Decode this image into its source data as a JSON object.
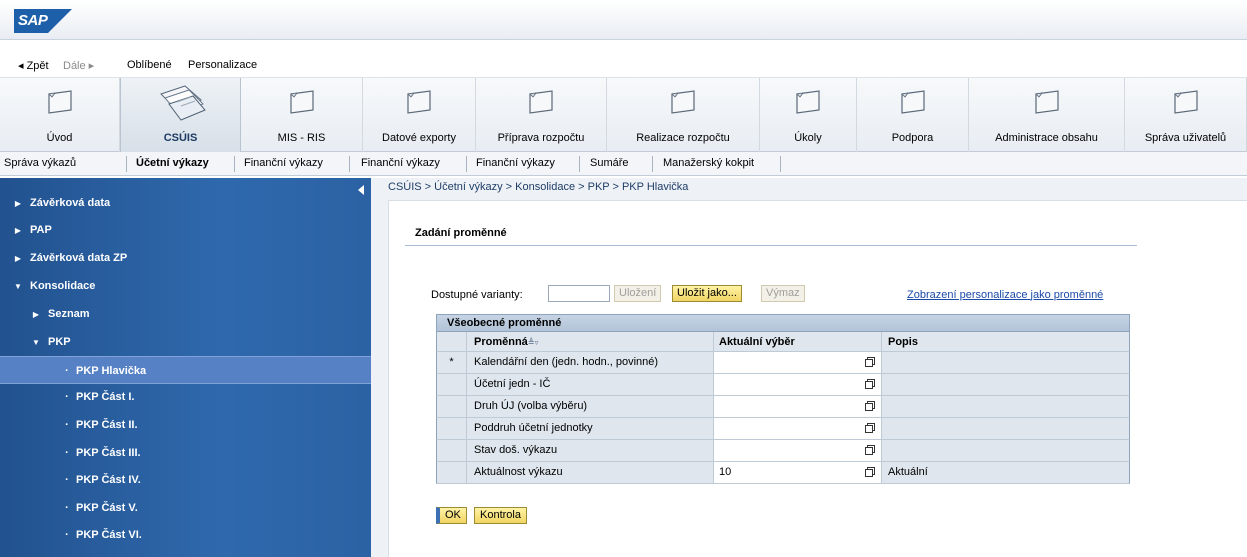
{
  "brand": {
    "logo_text": "SAP",
    "color": "#1d5fa8"
  },
  "history": {
    "back": "◂ Zpět",
    "forward": "Dále ▸",
    "favorites": "Oblíbené",
    "personalize": "Personalizace"
  },
  "top_nav": [
    {
      "label": "Úvod",
      "active": false
    },
    {
      "label": "CSÚIS",
      "active": true
    },
    {
      "label": "MIS - RIS",
      "active": false
    },
    {
      "label": "Datové exporty",
      "active": false
    },
    {
      "label": "Příprava rozpočtu",
      "active": false
    },
    {
      "label": "Realizace rozpočtu",
      "active": false
    },
    {
      "label": "Úkoly",
      "active": false
    },
    {
      "label": "Podpora",
      "active": false
    },
    {
      "label": "Administrace obsahu",
      "active": false
    },
    {
      "label": "Správa uživatelů",
      "active": false
    }
  ],
  "sub_nav": [
    {
      "label": "Správa výkazů",
      "active": false
    },
    {
      "label": "Účetní výkazy",
      "active": true
    },
    {
      "label": "Finanční výkazy",
      "active": false
    },
    {
      "label": "Finanční výkazy",
      "active": false
    },
    {
      "label": "Finanční výkazy",
      "active": false
    },
    {
      "label": "Sumáře",
      "active": false
    },
    {
      "label": "Manažerský kokpit",
      "active": false
    }
  ],
  "left_nav": [
    {
      "label": "Závěrková data",
      "level": 0,
      "expanded": false,
      "selected": false
    },
    {
      "label": "PAP",
      "level": 0,
      "expanded": false,
      "selected": false
    },
    {
      "label": "Závěrková data ZP",
      "level": 0,
      "expanded": false,
      "selected": false
    },
    {
      "label": "Konsolidace",
      "level": 0,
      "expanded": true,
      "selected": false
    },
    {
      "label": "Seznam",
      "level": 1,
      "expanded": false,
      "selected": false
    },
    {
      "label": "PKP",
      "level": 1,
      "expanded": true,
      "selected": false
    },
    {
      "label": "PKP Hlavička",
      "level": 2,
      "selected": true
    },
    {
      "label": "PKP Část I.",
      "level": 2,
      "selected": false
    },
    {
      "label": "PKP Část II.",
      "level": 2,
      "selected": false
    },
    {
      "label": "PKP Část III.",
      "level": 2,
      "selected": false
    },
    {
      "label": "PKP Část IV.",
      "level": 2,
      "selected": false
    },
    {
      "label": "PKP Část V.",
      "level": 2,
      "selected": false
    },
    {
      "label": "PKP Část VI.",
      "level": 2,
      "selected": false
    }
  ],
  "breadcrumb": "CSÚIS  >  Účetní výkazy  >  Konsolidace  >  PKP  >  PKP Hlavička",
  "panel": {
    "title": "Zadání proměnné",
    "variants_label": "Dostupné varianty:",
    "variants_value": "",
    "save_label": "Uložení",
    "save_as_label": "Uložit jako...",
    "delete_label": "Výmaz",
    "personalize_link_a": "Zobrazení personalizace",
    "personalize_link_b": "jako proměnné"
  },
  "variables_table": {
    "caption": "Všeobecné proměnné",
    "headers": {
      "variable": "Proměnná",
      "sort_glyph": "≜▿",
      "current": "Aktuální výběr",
      "description": "Popis"
    },
    "rows": [
      {
        "mark": "*",
        "variable": "Kalendářní den (jedn. hodn., povinné)",
        "current": "",
        "description": ""
      },
      {
        "mark": "",
        "variable": "Účetní jedn - IČ",
        "current": "",
        "description": ""
      },
      {
        "mark": "",
        "variable": "Druh ÚJ (volba výběru)",
        "current": "",
        "description": ""
      },
      {
        "mark": "",
        "variable": "Poddruh účetní jednotky",
        "current": "",
        "description": ""
      },
      {
        "mark": "",
        "variable": "Stav doš. výkazu",
        "current": "",
        "description": ""
      },
      {
        "mark": "",
        "variable": "Aktuálnost výkazu",
        "current": "10",
        "description": "Aktuální"
      }
    ]
  },
  "actions": {
    "ok_label": "OK",
    "check_label": "Kontrola"
  },
  "colors": {
    "nav_blue": "#2f69ad",
    "nav_selected": "#5681c4",
    "button_yellow": "#f1d463",
    "link_blue": "#1a4aa8"
  }
}
